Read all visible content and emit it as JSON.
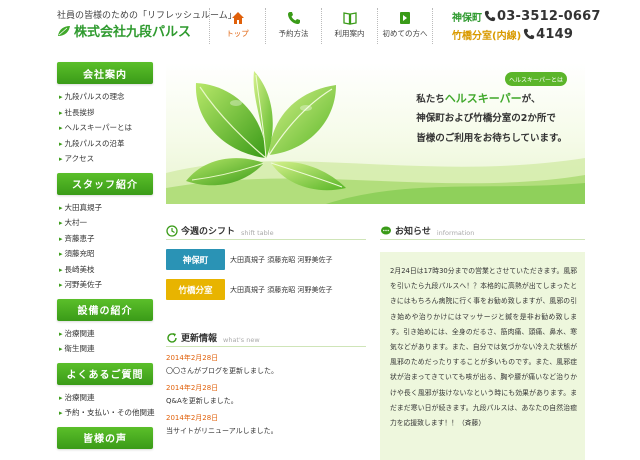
{
  "header": {
    "tagline": "社員の皆様のための「リフレッシュルーム」",
    "company": "株式会社九段パルス",
    "nav": [
      {
        "label": "トップ",
        "icon": "home-icon"
      },
      {
        "label": "予約方法",
        "icon": "phone-icon"
      },
      {
        "label": "利用案内",
        "icon": "book-icon"
      },
      {
        "label": "初めての方へ",
        "icon": "guide-book-icon"
      }
    ],
    "contact": [
      {
        "location": "神保町",
        "number": "03-3512-0667"
      },
      {
        "location": "竹橋分室(内線)",
        "number": "4149"
      }
    ]
  },
  "sidebar": {
    "sections": [
      {
        "title": "会社案内",
        "items": [
          "九段パルスの理念",
          "社長挨拶",
          "ヘルスキーパーとは",
          "九段パルスの沿革",
          "アクセス"
        ]
      },
      {
        "title": "スタッフ紹介",
        "items": [
          "大田真規子",
          "大村一",
          "斉藤恵子",
          "須藤充昭",
          "長崎美枝",
          "河野美佐子"
        ]
      },
      {
        "title": "設備の紹介",
        "items": [
          "治療関連",
          "衛生関連"
        ]
      },
      {
        "title": "よくあるご質問",
        "items": [
          "治療関連",
          "予約・支払い・その他関連"
        ]
      },
      {
        "title": "皆様の声",
        "items": []
      }
    ]
  },
  "hero": {
    "badge": "ヘルスキーパーとは",
    "line1_pre": "私たち",
    "line1_em": "ヘルスキーパー",
    "line1_post": "が、",
    "line2": "神保町および竹橋分室の2か所で",
    "line3": "皆様のご利用をお待ちしています。"
  },
  "shift": {
    "title": "今週のシフト",
    "subtitle": "shift table",
    "rows": [
      {
        "label": "神保町",
        "names": "大田真規子 須藤充昭 河野美佐子"
      },
      {
        "label": "竹橋分室",
        "names": "大田真規子 須藤充昭 河野美佐子"
      }
    ]
  },
  "news": {
    "title": "更新情報",
    "subtitle": "what's new",
    "items": [
      {
        "date": "2014年2月28日",
        "text": "〇〇さんがブログを更新しました。"
      },
      {
        "date": "2014年2月28日",
        "text": "Q&Aを更新しました。"
      },
      {
        "date": "2014年2月28日",
        "text": "当サイトがリニューアルしました。"
      }
    ]
  },
  "notice": {
    "title": "お知らせ",
    "subtitle": "information",
    "body": "2月24日は17時30分までの営業とさせていただきます。風邪を引いたら九段パルスへ！？本格的に高熱が出てしまったときにはもちろん病院に行く事をお勧め致しますが、風邪の引き始めや治りかけにはマッサージと鍼を是非お勧め致します。引き始めには、全身のだるさ、筋肉痛、頭痛、鼻水、寒気などがあります。また、自分では気づかない冷えた状態が風邪のためだったりすることが多いものです。また、風邪症状が治まってきていても咳が出る、胸や腰が痛いなど治りかけや長く風邪が抜けないなという時にも効果があります。まだまだ寒い日が続きます。九段パルスは、あなたの自然治癒力を応援致します！！（斉藤）"
  },
  "colors": {
    "brand_green": "#3a9b18",
    "accent_orange": "#e0600a",
    "shift_blue": "#2a93b5",
    "shift_yellow": "#e8b400"
  }
}
